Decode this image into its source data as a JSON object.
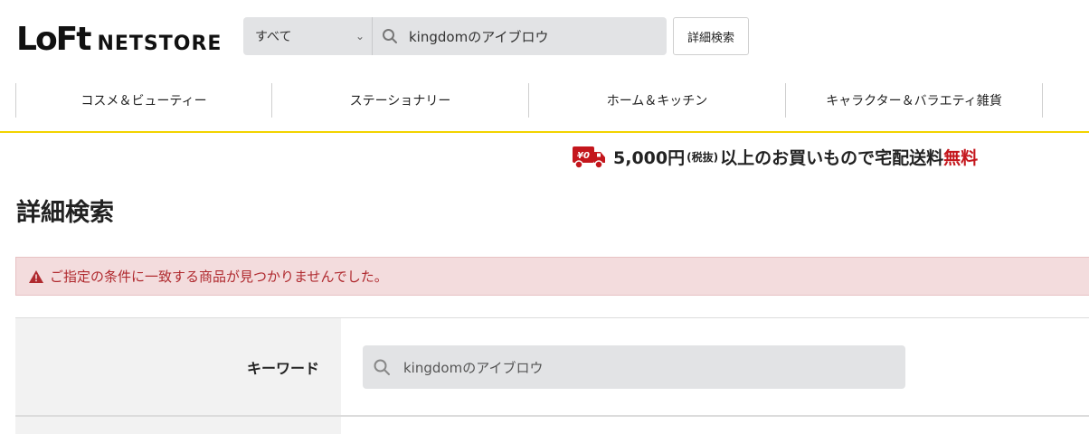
{
  "header": {
    "logo_loft": "LoFt",
    "logo_netstore": "NETSTORE",
    "category_select": "すべて",
    "search_value": "kingdomのアイブロウ",
    "advanced_search_button": "詳細検索"
  },
  "nav": {
    "items": [
      {
        "label": "コスメ＆ビューティー"
      },
      {
        "label": "ステーショナリー"
      },
      {
        "label": "ホーム＆キッチン"
      },
      {
        "label": "キャラクター＆バラエティ雑貨"
      },
      {
        "label": ""
      }
    ]
  },
  "shipping_banner": {
    "badge": "¥0",
    "amount": "5,000円",
    "tax_note": "(税抜)",
    "text": "以上のお買いもので宅配送料",
    "free": "無料"
  },
  "page": {
    "title": "詳細検索",
    "alert": "ご指定の条件に一致する商品が見つかりませんでした。"
  },
  "form": {
    "keyword_label": "キーワード",
    "keyword_value": "kingdomのアイブロウ"
  },
  "colors": {
    "accent_yellow": "#f2d300",
    "alert_bg": "#f3dcdd",
    "alert_text": "#b02a2f",
    "free_red": "#c4161c",
    "input_bg": "#e2e3e5"
  }
}
